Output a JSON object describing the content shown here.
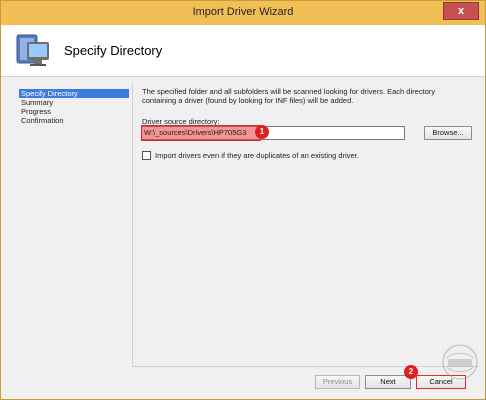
{
  "window": {
    "title": "Import Driver Wizard",
    "close_label": "x"
  },
  "header": {
    "title": "Specify Directory",
    "icon": "computer-wizard-icon"
  },
  "sidebar": {
    "items": [
      {
        "label": "Specify Directory",
        "active": true
      },
      {
        "label": "Summary",
        "active": false
      },
      {
        "label": "Progress",
        "active": false
      },
      {
        "label": "Confirmation",
        "active": false
      }
    ]
  },
  "content": {
    "description": "The specified folder and all subfolders will be scanned looking for drivers. Each directory containing a driver (found by looking for INF files) will be added.",
    "source_label": "Driver source directory:",
    "source_value": "W:\\_sources\\Drivers\\HP705G3",
    "browse_label": "Browse...",
    "duplicate_checkbox_label": "Import drivers even if they are duplicates of an existing driver.",
    "duplicate_checked": false
  },
  "annotations": {
    "badge_1": "1",
    "badge_2": "2"
  },
  "footer": {
    "previous_label": "Previous",
    "next_label": "Next",
    "cancel_label": "Cancel"
  },
  "colors": {
    "titlebar": "#f2bf55",
    "selection": "#3d7be0",
    "annotation": "#e31e1e"
  }
}
